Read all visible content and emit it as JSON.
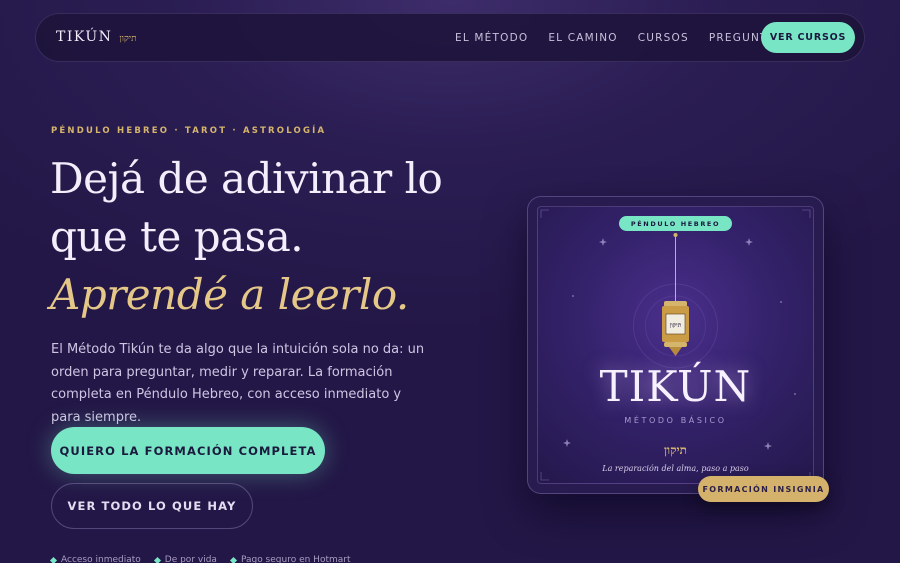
{
  "nav": {
    "brand_name": "TIKÚN",
    "brand_hebrew": "תיקון",
    "links": [
      "EL MÉTODO",
      "EL CAMINO",
      "CURSOS",
      "PREGUNTAS"
    ],
    "cta_label": "VER CURSOS"
  },
  "hero": {
    "eyebrow": "PÉNDULO HEBREO · TAROT · ASTROLOGÍA",
    "headline_line1": "Dejá de adivinar lo",
    "headline_line2": "que te pasa.",
    "headline_accent": "Aprendé a leerlo.",
    "lead": "El Método Tikún te da algo que la intuición sola no da: un orden para preguntar, medir y reparar. La formación completa en Péndulo Hebreo, con acceso inmediato y para siempre.",
    "primary_cta": "QUIERO LA FORMACIÓN COMPLETA",
    "secondary_cta": "VER TODO LO QUE HAY",
    "trust_items": [
      "Acceso inmediato",
      "De por vida",
      "Pago seguro en Hotmart"
    ]
  },
  "card": {
    "badge_top": "PÉNDULO HEBREO",
    "pendulum_label": "תיקון",
    "title": "TIKÚN",
    "subtitle": "MÉTODO BÁSICO",
    "hebrew": "תיקון",
    "tagline": "La reparación del alma, paso a paso",
    "badge_bottom": "FORMACIÓN INSIGNIA"
  },
  "colors": {
    "accent_mint": "#78e6c4",
    "accent_gold": "#d5b56c",
    "background": "#2a1d52"
  }
}
